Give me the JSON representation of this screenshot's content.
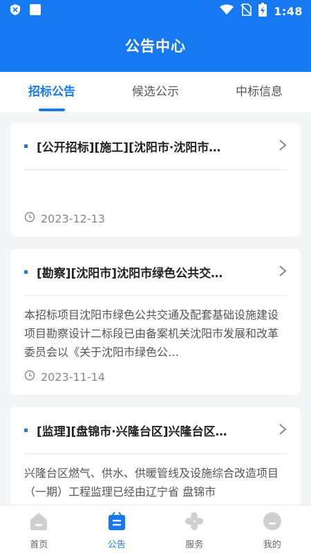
{
  "status_bar": {
    "time": "1:48"
  },
  "header": {
    "title": "公告中心"
  },
  "tabs": [
    {
      "label": "招标公告",
      "active": true
    },
    {
      "label": "候选公示",
      "active": false
    },
    {
      "label": "中标信息",
      "active": false
    }
  ],
  "items": [
    {
      "title": "[公开招标][施工][沈阳市·沈阳市…",
      "summary": "",
      "date": "2023-12-13"
    },
    {
      "title": "[勘察][沈阳市]沈阳市绿色公共交…",
      "summary": "本招标项目沈阳市绿色公共交通及配套基础设施建设项目勘察设计二标段已由备案机关沈阳市发展和改革委员会以《关于沈阳市绿色公…",
      "date": "2023-11-14"
    },
    {
      "title": "[监理][盘锦市·兴隆台区]兴隆台区…",
      "summary": "兴隆台区燃气、供水、供暖管线及设施综合改造项目（一期）工程监理已经由辽宁省 盘锦市",
      "date": ""
    }
  ],
  "bottom_nav": [
    {
      "label": "首页",
      "icon": "home-icon",
      "active": false
    },
    {
      "label": "公告",
      "icon": "notice-icon",
      "active": true
    },
    {
      "label": "服务",
      "icon": "service-icon",
      "active": false
    },
    {
      "label": "我的",
      "icon": "profile-icon",
      "active": false
    }
  ],
  "colors": {
    "primary": "#1679f2",
    "background": "#f4f5f7",
    "inactive_icon": "#cfcfcf"
  }
}
